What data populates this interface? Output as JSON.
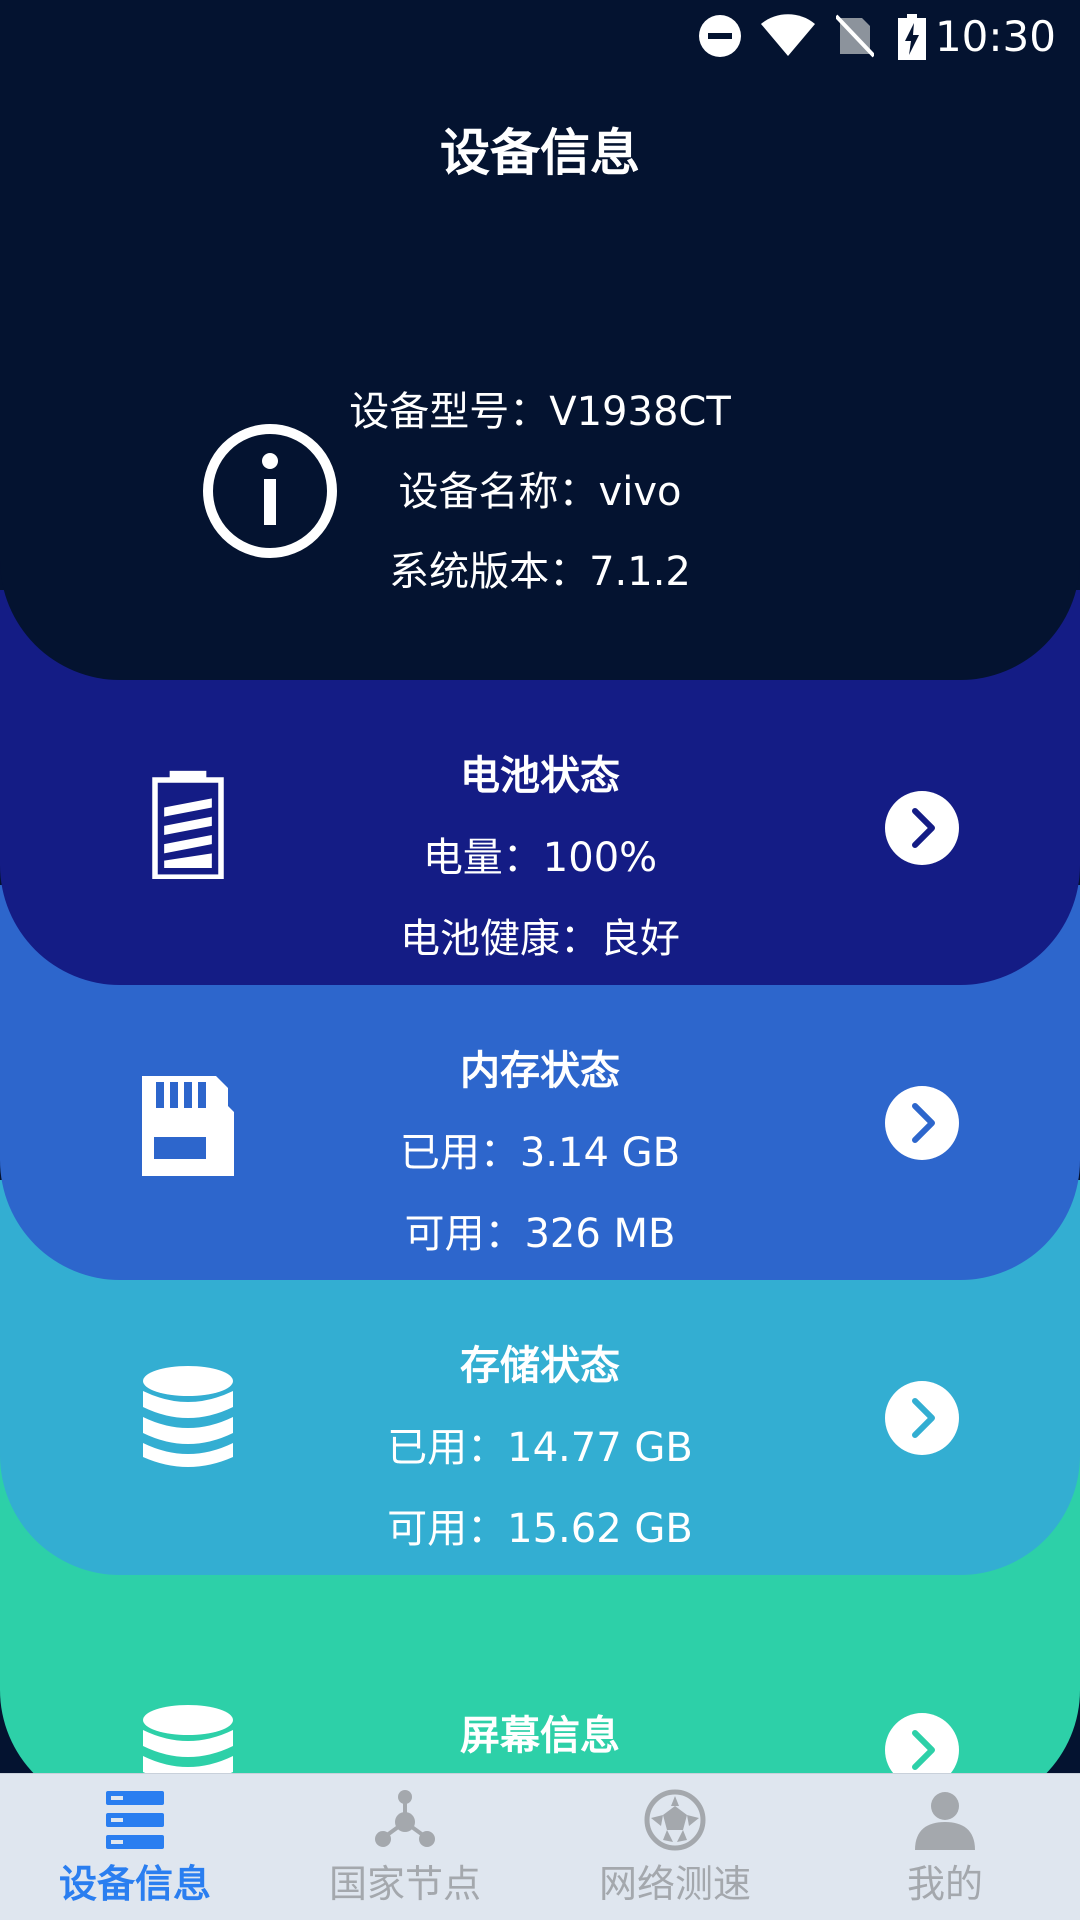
{
  "status_bar": {
    "time": "10:30",
    "icons": [
      "do-not-disturb-icon",
      "wifi-icon",
      "no-sim-icon",
      "battery-charging-icon"
    ]
  },
  "header": {
    "title": "设备信息"
  },
  "device": {
    "icon": "info-icon",
    "model": "设备型号：V1938CT",
    "name": "设备名称：vivo",
    "version": "系统版本：7.1.2"
  },
  "battery": {
    "title": "电池状态",
    "level": "电量：100%",
    "health": "电池健康：良好",
    "icon": "battery-icon"
  },
  "memory": {
    "title": "内存状态",
    "used": "已用：3.14 GB",
    "available": "可用：326 MB",
    "icon": "sd-card-icon"
  },
  "storage": {
    "title": "存储状态",
    "used": "已用：14.77 GB",
    "available": "可用：15.62 GB",
    "icon": "database-icon"
  },
  "screen": {
    "title": "屏幕信息",
    "icon": "database-icon"
  },
  "bottom_nav": {
    "items": [
      {
        "label": "设备信息",
        "icon": "device-info-icon",
        "active": true
      },
      {
        "label": "国家节点",
        "icon": "network-nodes-icon",
        "active": false
      },
      {
        "label": "网络测速",
        "icon": "speed-test-icon",
        "active": false
      },
      {
        "label": "我的",
        "icon": "user-icon",
        "active": false
      }
    ]
  },
  "colors": {
    "header_bg": "#041330",
    "battery_bg": "#141c85",
    "memory_bg": "#2d66cc",
    "storage_bg": "#33aed2",
    "screen_bg": "#2dd0a8",
    "nav_bg": "#dfe6ef",
    "nav_active": "#2a7ef0",
    "nav_inactive": "#a4a8ad"
  }
}
